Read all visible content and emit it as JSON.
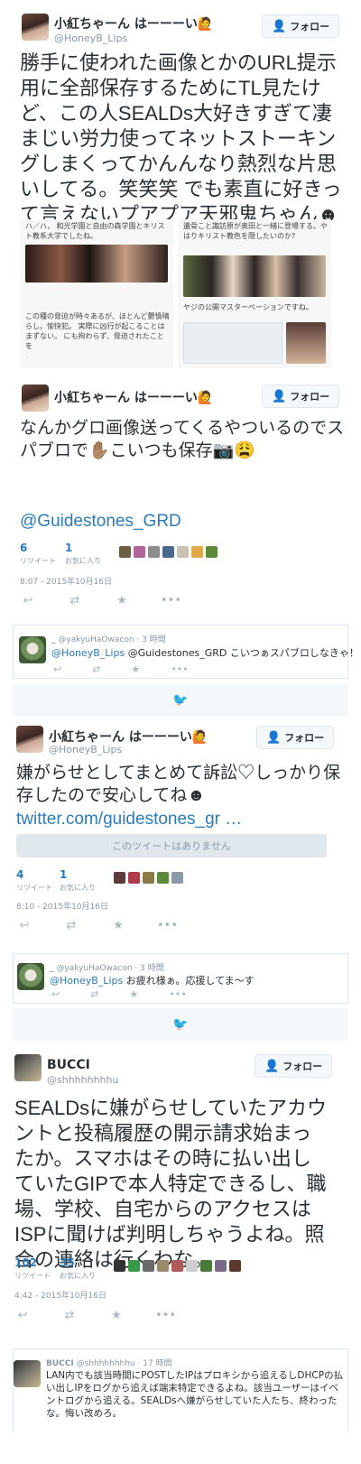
{
  "tweets": [
    {
      "name": "小紅ちゃーん はーーーい🙋",
      "handle": "@HoneyB_Lips",
      "follow": "フォロー",
      "text": "勝手に使われた画像とかのURL提示用に全部保存するためにTL見たけど、この人SEALDs大好きすぎて凄まじい労力使ってネットストーキングしまくってかんんなり熱烈な片思いしてる。笑笑笑 でも素直に好きって言えないプアプア天邪鬼ちゃん☻",
      "media_left": "ハ／ハ，\n和光学園と自由の森学園とキリスト教系大学でしたね。",
      "media_left_caption": "この種の脅迫が時々あるが、ほとんど鬱憤晴らし。愉快犯。\n実際に凶行が起こることはまずない。\nにも拘わらず、脅迫されたことを",
      "media_right": "遺骨こと諏訪原が奥田と一緒に登場する。やはりキリスト教色を隠したいのか?",
      "media_right_caption": "ヤジの公開マスターベーションですね。"
    },
    {
      "name": "小紅ちゃーん はーーーい🙋",
      "handle": "",
      "follow": "フォロー",
      "text1": "なんかグロ画像送ってくるやついるのでスパブロで✋🏽こいつも保存📷😩",
      "link": "@Guidestones_GRD",
      "retweets": "6",
      "retweets_label": "リツイート",
      "likes": "1",
      "likes_label": "お気に入り",
      "timestamp": "8:07 - 2015年10月16日"
    },
    {
      "name": "小紅ちゃーん はーーーい🙋",
      "handle": "@HoneyB_Lips",
      "follow": "フォロー",
      "text": "嫌がらせとしてまとめて訴訟♡しっかり保存したので安心してね☻",
      "link": "twitter.com/guidestones_gr …",
      "unavailable": "このツイートはありません",
      "retweets": "4",
      "retweets_label": "リツイート",
      "likes": "1",
      "likes_label": "お気に入り",
      "timestamp": "8:10 - 2015年10月16日"
    },
    {
      "name": "BUCCI",
      "handle": "@shhhhhhhhu",
      "follow": "フォロー",
      "text": "SEALDsに嫌がらせしていたアカウントと投稿履歴の開示請求始まったか。スマホはその時に払い出していたGIPで本人特定できるし、職場、学校、自宅からのアクセスはISPに聞けば判明しちゃうよね。照合の連絡は行くわな。",
      "retweets": "102",
      "retweets_label": "リツイート",
      "likes": "35",
      "likes_label": "お気に入り",
      "timestamp": "4:42 - 2015年10月16日"
    }
  ],
  "replies": [
    {
      "name": "_",
      "handle": "@yakyuHaOwacon · 3 時間",
      "mention": "@HoneyB_Lips",
      "text": " @Guidestones_GRD こいつぁスパブロしなきゃ！"
    },
    {
      "name": "_",
      "handle": "@yakyuHaOwacon · 3 時間",
      "mention": "@HoneyB_Lips",
      "text": " お疲れ様ぁ。応援してま～す"
    },
    {
      "name": "BUCCI",
      "handle": "@shhhhhhhhu · 17 時間",
      "text": "LAN内でも該当時間にPOSTしたIPはプロキシから追えるしDHCPの払い出しIPをログから追えば端末特定できるよね。該当ユーザーはイベントログから追える。SEALDsへ嫌がらせしていた人たち、終わったな。悔い改めろ。"
    }
  ],
  "colors": {
    "link": "#2b7bb9",
    "muted": "#8899a6",
    "accent": "#55acee"
  }
}
